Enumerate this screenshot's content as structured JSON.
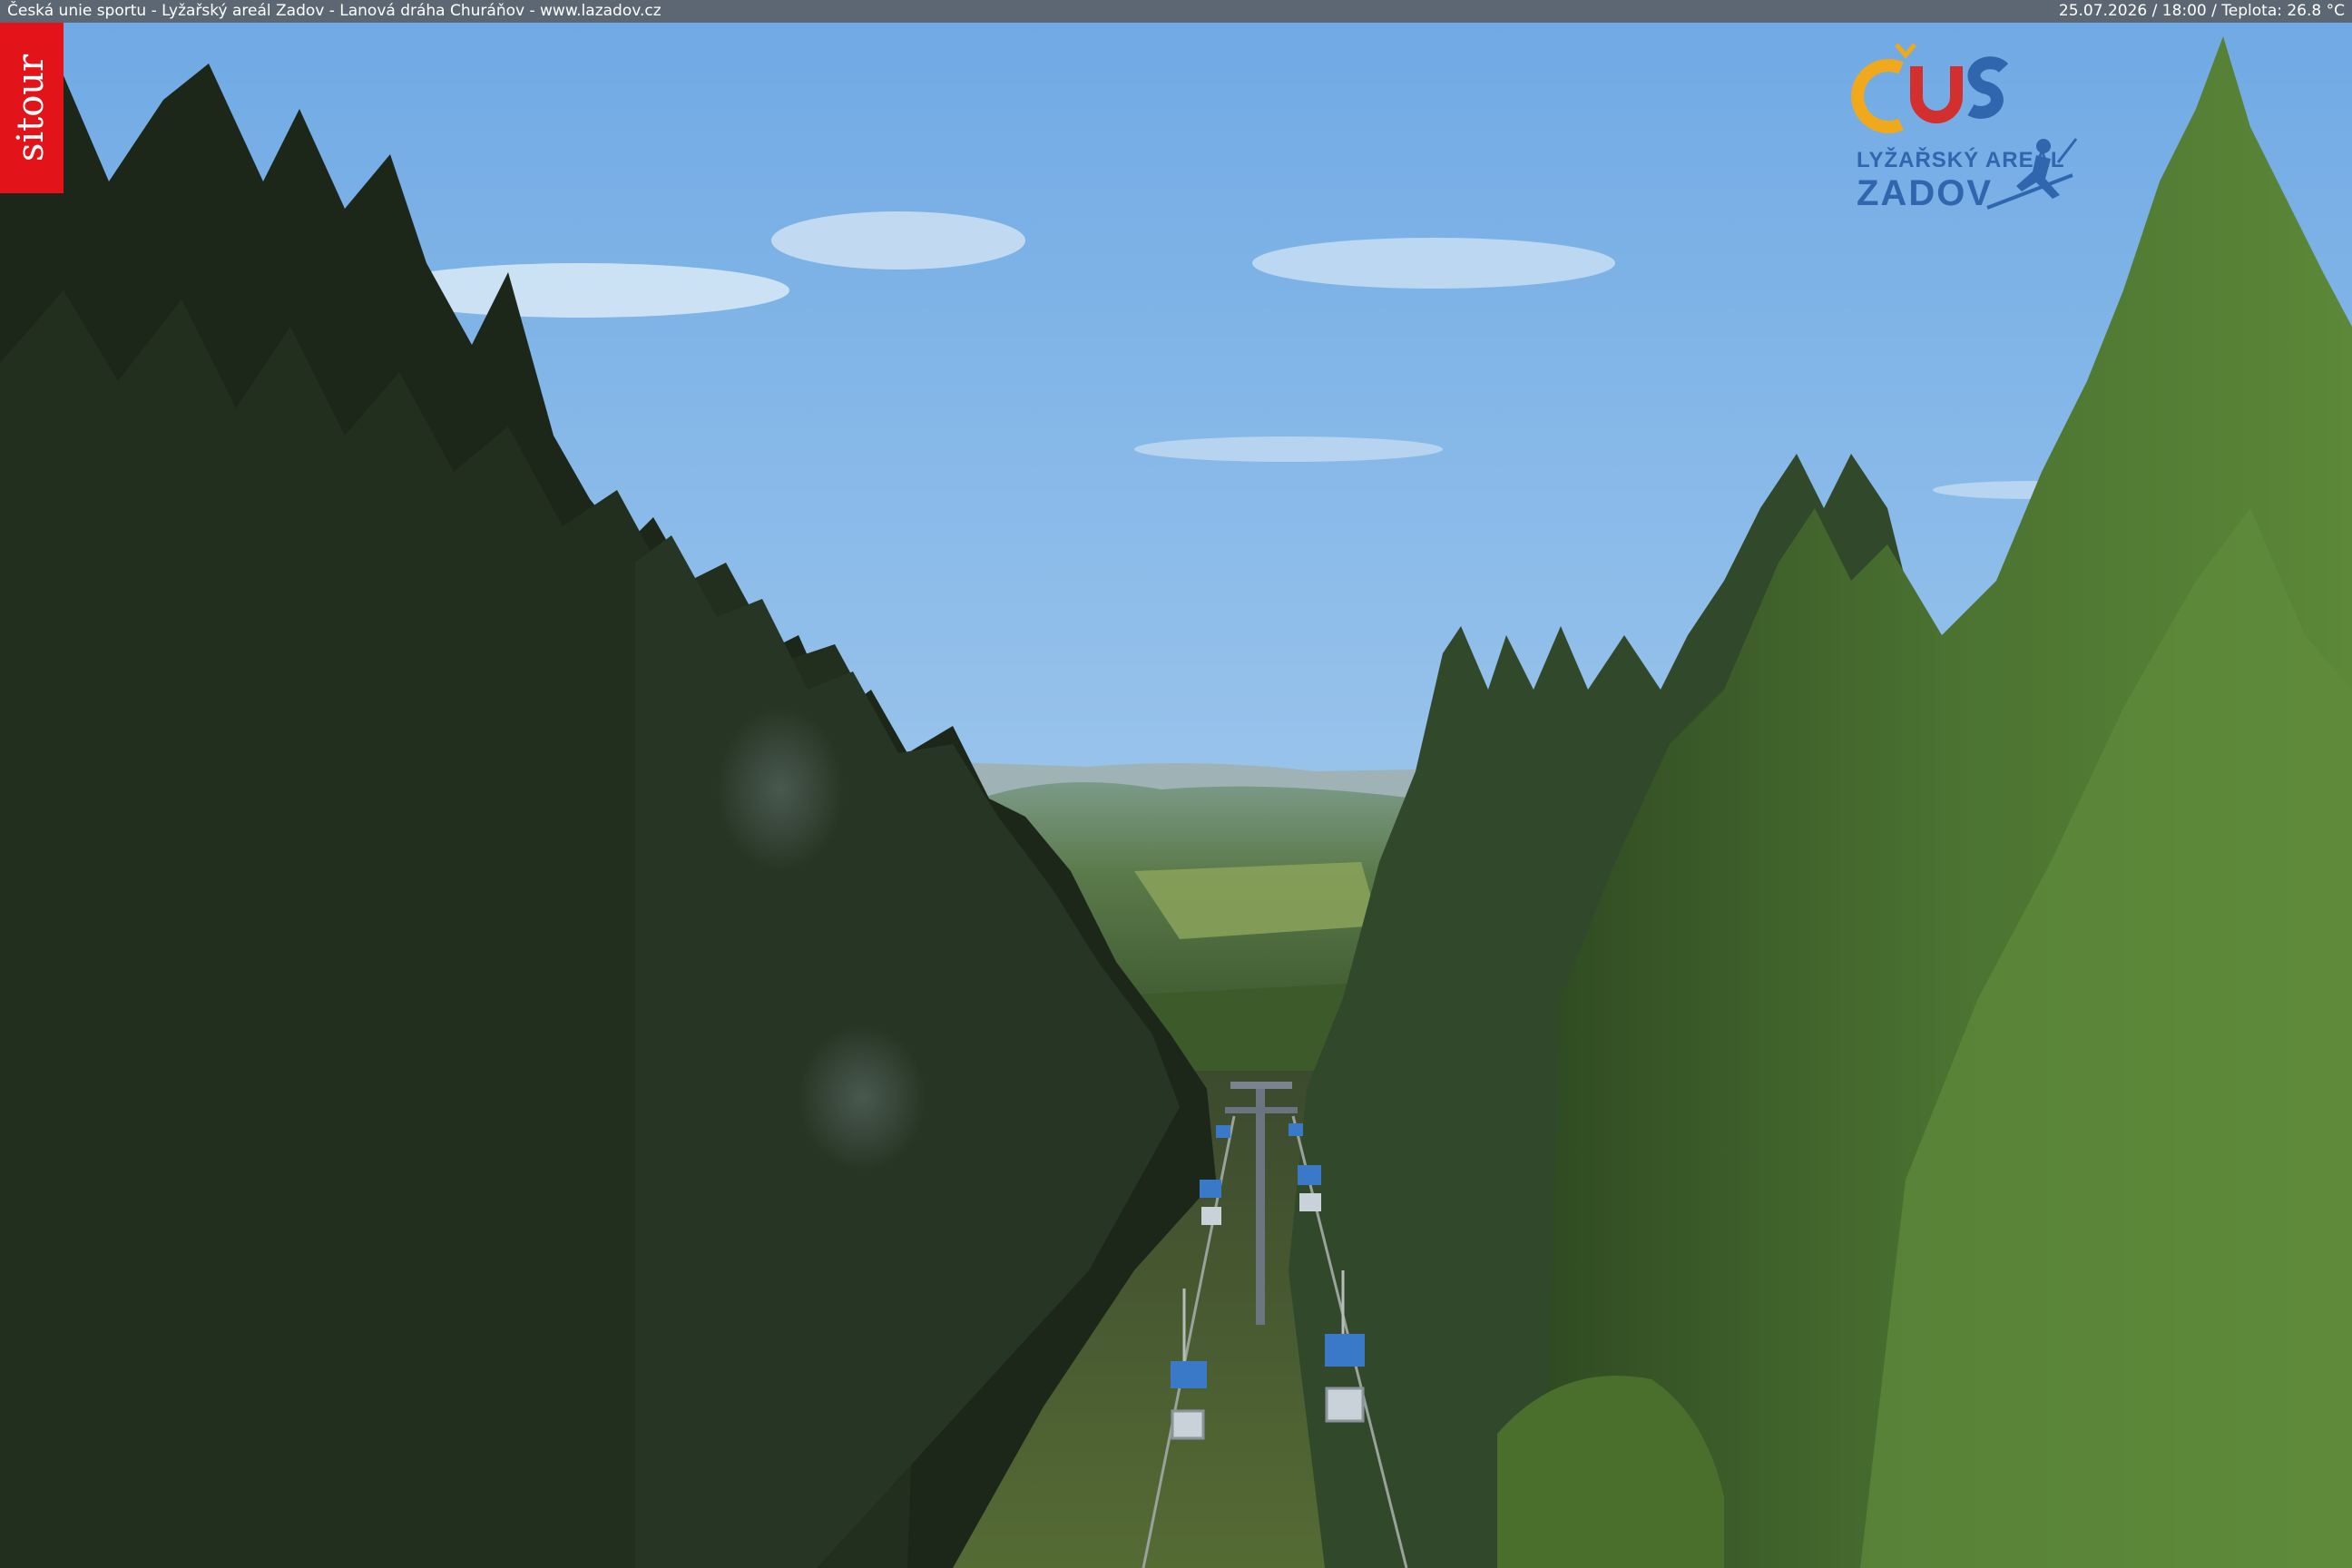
{
  "header": {
    "caption": "Česká unie sportu - Lyžařský areál Zadov - Lanová dráha Churáňov - www.lazadov.cz",
    "status": "25.07.2026 / 18:00 / Teplota: 26.8 °C"
  },
  "watermark": {
    "label": "sitour",
    "color": "#e3131a"
  },
  "logo": {
    "mark": "ČUS",
    "line1": "LYŽAŘSKÝ AREÁL",
    "line2": "ZADOV",
    "colors": {
      "c": "#f0a81c",
      "u": "#d32f2f",
      "s": "#2f66ad",
      "text": "#2f66ad"
    }
  },
  "scene": {
    "description_icon": "chairlift-forest-view-icon",
    "colors": {
      "sky_top": "#74aee6",
      "sky_horizon": "#d3e4ec",
      "forest_dark": "#1f2b1c",
      "forest_sunlit": "#4f7a32",
      "chair": "#3a78c8"
    }
  }
}
